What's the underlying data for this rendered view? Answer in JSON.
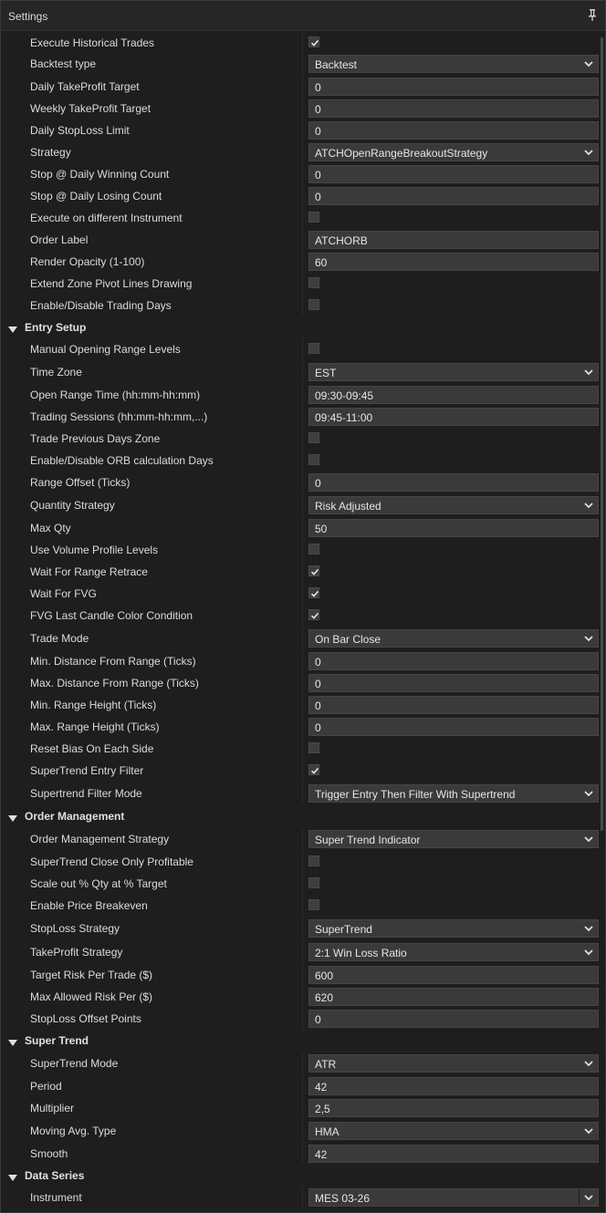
{
  "window": {
    "title": "Settings",
    "pin_icon": "pin-icon"
  },
  "colors": {
    "background": "#1e1e1e",
    "field": "#3a3a3a",
    "text": "#dcdcdc"
  },
  "general": [
    {
      "label": "Execute Historical Trades",
      "type": "checkbox",
      "checked": true
    },
    {
      "label": "Backtest type",
      "type": "select",
      "value": "Backtest"
    },
    {
      "label": "Daily TakeProfit Target",
      "type": "input",
      "value": "0"
    },
    {
      "label": "Weekly TakeProfit Target",
      "type": "input",
      "value": "0"
    },
    {
      "label": "Daily StopLoss Limit",
      "type": "input",
      "value": "0"
    },
    {
      "label": "Strategy",
      "type": "select",
      "value": "ATCHOpenRangeBreakoutStrategy"
    },
    {
      "label": "Stop @ Daily Winning Count",
      "type": "input",
      "value": "0"
    },
    {
      "label": "Stop @ Daily Losing Count",
      "type": "input",
      "value": "0"
    },
    {
      "label": "Execute on different Instrument",
      "type": "checkbox",
      "checked": false
    },
    {
      "label": "Order Label",
      "type": "input",
      "value": "ATCHORB"
    },
    {
      "label": "Render Opacity (1-100)",
      "type": "input",
      "value": "60"
    },
    {
      "label": "Extend Zone Pivot Lines Drawing",
      "type": "checkbox",
      "checked": false
    },
    {
      "label": "Enable/Disable Trading Days",
      "type": "checkbox",
      "checked": false
    }
  ],
  "sections": {
    "entry": {
      "title": "Entry Setup",
      "rows": [
        {
          "label": "Manual Opening Range Levels",
          "type": "checkbox",
          "checked": false
        },
        {
          "label": "Time Zone",
          "type": "select",
          "value": "EST"
        },
        {
          "label": "Open Range Time (hh:mm-hh:mm)",
          "type": "input",
          "value": "09:30-09:45"
        },
        {
          "label": "Trading Sessions (hh:mm-hh:mm,...)",
          "type": "input",
          "value": "09:45-11:00"
        },
        {
          "label": "Trade Previous Days Zone",
          "type": "checkbox",
          "checked": false
        },
        {
          "label": "Enable/Disable ORB calculation Days",
          "type": "checkbox",
          "checked": false
        },
        {
          "label": "Range Offset (Ticks)",
          "type": "input",
          "value": "0"
        },
        {
          "label": "Quantity Strategy",
          "type": "select",
          "value": "Risk Adjusted"
        },
        {
          "label": "Max Qty",
          "type": "input",
          "value": "50"
        },
        {
          "label": "Use Volume Profile Levels",
          "type": "checkbox",
          "checked": false
        },
        {
          "label": "Wait For Range Retrace",
          "type": "checkbox",
          "checked": true
        },
        {
          "label": "Wait For FVG",
          "type": "checkbox",
          "checked": true
        },
        {
          "label": "FVG Last Candle Color Condition",
          "type": "checkbox",
          "checked": true
        },
        {
          "label": "Trade Mode",
          "type": "select",
          "value": "On Bar Close"
        },
        {
          "label": "Min. Distance From Range (Ticks)",
          "type": "input",
          "value": "0"
        },
        {
          "label": "Max. Distance From Range (Ticks)",
          "type": "input",
          "value": "0"
        },
        {
          "label": "Min. Range Height (Ticks)",
          "type": "input",
          "value": "0"
        },
        {
          "label": "Max. Range Height (Ticks)",
          "type": "input",
          "value": "0"
        },
        {
          "label": "Reset Bias On Each Side",
          "type": "checkbox",
          "checked": false
        },
        {
          "label": "SuperTrend Entry Filter",
          "type": "checkbox",
          "checked": true
        },
        {
          "label": "Supertrend Filter Mode",
          "type": "select",
          "value": "Trigger Entry Then Filter With Supertrend"
        }
      ]
    },
    "order": {
      "title": "Order Management",
      "rows": [
        {
          "label": "Order Management Strategy",
          "type": "select",
          "value": "Super Trend Indicator"
        },
        {
          "label": "SuperTrend Close Only Profitable",
          "type": "checkbox",
          "checked": false
        },
        {
          "label": "Scale out % Qty at % Target",
          "type": "checkbox",
          "checked": false
        },
        {
          "label": "Enable Price Breakeven",
          "type": "checkbox",
          "checked": false
        },
        {
          "label": "StopLoss Strategy",
          "type": "select",
          "value": "SuperTrend"
        },
        {
          "label": "TakeProfit Strategy",
          "type": "select",
          "value": "2:1 Win Loss Ratio"
        },
        {
          "label": "Target Risk Per Trade ($)",
          "type": "input",
          "value": "600"
        },
        {
          "label": "Max Allowed Risk Per ($)",
          "type": "input",
          "value": "620"
        },
        {
          "label": "StopLoss Offset Points",
          "type": "input",
          "value": "0"
        }
      ]
    },
    "supertrend": {
      "title": "Super Trend",
      "rows": [
        {
          "label": "SuperTrend Mode",
          "type": "select",
          "value": "ATR"
        },
        {
          "label": "Period",
          "type": "input",
          "value": "42"
        },
        {
          "label": "Multiplier",
          "type": "input",
          "value": "2,5"
        },
        {
          "label": "Moving Avg. Type",
          "type": "select",
          "value": "HMA"
        },
        {
          "label": "Smooth",
          "type": "input",
          "value": "42"
        }
      ]
    },
    "dataseries": {
      "title": "Data Series",
      "rows": [
        {
          "label": "Instrument",
          "type": "select",
          "value": "MES 03-26"
        }
      ]
    }
  }
}
